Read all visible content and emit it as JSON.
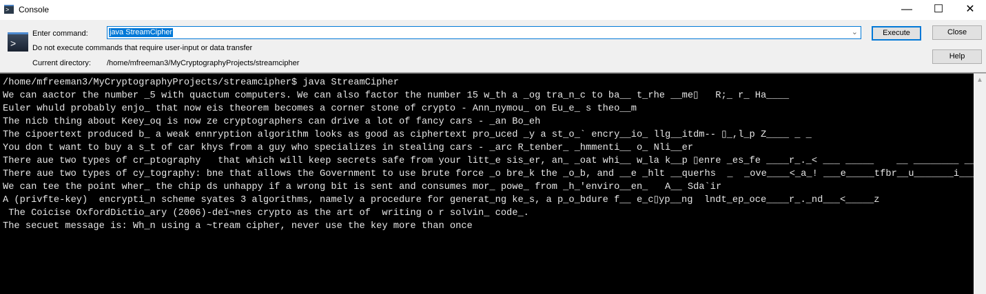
{
  "window": {
    "title": "Console",
    "minimize": "—",
    "maximize": "☐",
    "close": "✕"
  },
  "form": {
    "enter_command_label": "Enter command:",
    "command_value": "java StreamCipher",
    "warning": "Do not execute commands that require user-input or data transfer",
    "current_dir_label": "Current directory:",
    "current_dir": "/home/mfreeman3/MyCryptographyProjects/streamcipher"
  },
  "buttons": {
    "execute": "Execute",
    "close": "Close",
    "help": "Help"
  },
  "console": {
    "lines": [
      "/home/mfreeman3/MyCryptographyProjects/streamcipher$ java StreamCipher",
      "We can aactor the number _5 with quactum computers. We can also factor the number 15 w_th a _og tra_n_c to ba__ t_rhe __me▯   R;_ r_ Ha____",
      "Euler whuld probably enjo_ that now eis theorem becomes a corner stone of crypto - Ann_nymou_ on Eu_e_ s theo__m",
      "The nicb thing about Keey_oq is now ze cryptographers can drive a lot of fancy cars - _an Bo_eh",
      "The cipoertext produced b_ a weak ennryption algorithm looks as good as ciphertext pro_uced _y a st_o_` encry__io_ llg__itdm-- ▯_,l_p Z____ _ _",
      "You don t want to buy a s_t of car khys from a guy who specializes in stealing cars - _arc R_tenber_ _hmmenti__ o_ Nli__er",
      "There aue two types of cr_ptography   that which will keep secrets safe from your litt_e sis_er, an_ _oat whi__ w_la k__p ▯enre _es_fe ____r_._< ___ _____    __ ________ __",
      "There aue two types of cy_tography: bne that allows the Government to use brute force _o bre_k the _o_b, and __e _hlt __querhs  _  _ove____<_a_! ___e_____tfbr__u_______i_____",
      "We can tee the point wher_ the chip ds unhappy if a wrong bit is sent and consumes mor_ powe_ from _h_'enviro__en_   A__ Sda`ir",
      "A (privfte-key)  encrypti_n scheme syates 3 algorithms, namely a procedure for generat_ng ke_s, a p_o_bdure f__ e_c▯yp__ng  lndt_ep_oce____r_._nd___<_____z",
      " The Coicise OxfordDictio_ary (2006)-deï¬nes crypto as the art of  writing o r solvin_ code_.",
      "The secuet message is: Wh_n using a ~tream cipher, never use the key more than once"
    ]
  },
  "colors": {
    "console_bg": "#000000",
    "console_text": "#e6e6e6",
    "accent": "#0078d7"
  }
}
